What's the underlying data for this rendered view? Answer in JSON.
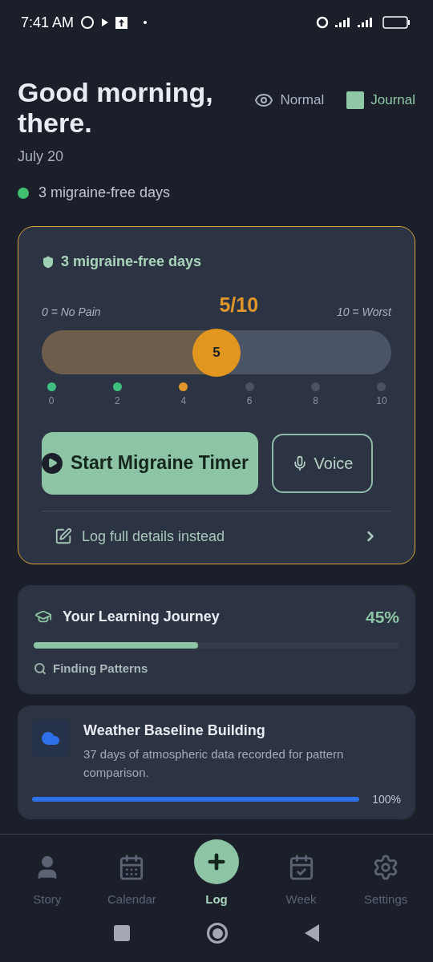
{
  "status_bar": {
    "time": "7:41 AM"
  },
  "header": {
    "greeting": "Good morning, there.",
    "date": "July 20",
    "streak": {
      "text": "3 migraine-free days",
      "color": "#3fbf6f"
    },
    "modes": [
      {
        "kind": "eye",
        "label": "Normal",
        "selected": false
      },
      {
        "kind": "note",
        "label": "Journal",
        "selected": true
      }
    ]
  },
  "pain_card": {
    "title": "3 migraine-free days",
    "min_label": "0 = No Pain",
    "max_label": "10 = Worst",
    "reading": "5/10",
    "level": 0.5,
    "thumb": "5",
    "scale": [
      {
        "label": "0",
        "color": "#3fbf7f"
      },
      {
        "label": "2",
        "color": "#3fbf7f"
      },
      {
        "label": "4",
        "color": "#e0962a"
      },
      {
        "label": "6",
        "color": "#4a5263"
      },
      {
        "label": "8",
        "color": "#4a5263"
      },
      {
        "label": "10",
        "color": "#4a5263"
      }
    ],
    "start_button": "Start Migraine Timer",
    "voice_button": "Voice",
    "details_link": "Log full details instead"
  },
  "learning": {
    "title": "Your Learning Journey",
    "percent": "45%",
    "level": 0.45,
    "stage": "Finding Patterns"
  },
  "weather": {
    "title": "Weather Baseline Building",
    "description": "37 days of atmospheric data recorded for pattern comparison.",
    "level": 1,
    "percent": "100%"
  },
  "nav": [
    {
      "kind": "person",
      "label": "Story",
      "selected": false
    },
    {
      "kind": "calendar",
      "label": "Calendar",
      "selected": false
    },
    {
      "kind": "plus",
      "label": "Log",
      "selected": true
    },
    {
      "kind": "week",
      "label": "Week",
      "selected": false
    },
    {
      "kind": "gear",
      "label": "Settings",
      "selected": false
    }
  ]
}
